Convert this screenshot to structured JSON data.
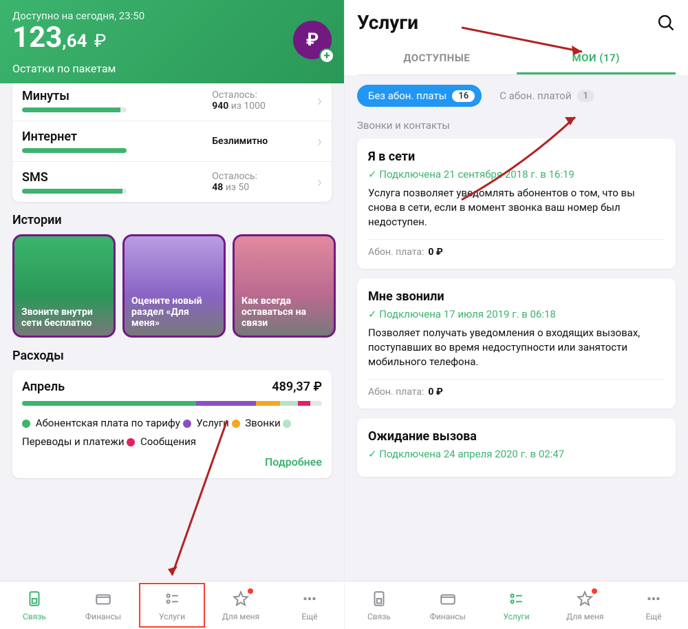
{
  "left": {
    "available_label": "Доступно на сегодня, 23:50",
    "balance_int": "123",
    "balance_dec": ",64",
    "balance_cur": "₽",
    "remain_label": "Остатки по пакетам",
    "packages": [
      {
        "title": "Минуты",
        "remain_label": "Осталось:",
        "remain_value": "940",
        "remain_of": "из 1000",
        "fill": 94
      },
      {
        "title": "Интернет",
        "remain_label": "",
        "remain_value": "Безлимитно",
        "remain_of": "",
        "fill": 100
      },
      {
        "title": "SMS",
        "remain_label": "Осталось:",
        "remain_value": "48",
        "remain_of": "из 50",
        "fill": 96
      }
    ],
    "stories_label": "Истории",
    "stories": [
      {
        "text": "Звоните внутри сети бесплатно"
      },
      {
        "text": "Оцените новый раздел «Для меня»"
      },
      {
        "text": "Как всегда оставаться на связи"
      }
    ],
    "expenses_label": "Расходы",
    "expenses": {
      "month": "Апрель",
      "amount": "489,37 ₽",
      "segments": [
        {
          "color": "#3cb46e",
          "w": 58
        },
        {
          "color": "#8a4fc7",
          "w": 20
        },
        {
          "color": "#f5a623",
          "w": 8
        },
        {
          "color": "#b6e3c6",
          "w": 6
        },
        {
          "color": "#e91e63",
          "w": 4
        },
        {
          "color": "#e5e5ea",
          "w": 4
        }
      ],
      "legend": [
        {
          "color": "#3cb46e",
          "label": "Абонентская плата по тарифу"
        },
        {
          "color": "#8a4fc7",
          "label": "Услуги"
        },
        {
          "color": "#f5a623",
          "label": "Звонки"
        },
        {
          "color": "#b6e3c6",
          "label": "Переводы и платежи"
        },
        {
          "color": "#e91e63",
          "label": "Сообщения"
        }
      ],
      "more": "Подробнее"
    }
  },
  "right": {
    "title": "Услуги",
    "tab_available": "ДОСТУПНЫЕ",
    "tab_my": "МОИ (17)",
    "chip_nofee": "Без абон. платы",
    "chip_nofee_n": "16",
    "chip_fee": "С абон. платой",
    "chip_fee_n": "1",
    "subsection": "Звонки и контакты",
    "services": [
      {
        "title": "Я в сети",
        "sub": "Подключена 21 сентября 2018 г. в 16:19",
        "desc": "Услуга позволяет уведомлять абонентов о том, что вы снова в сети, если в момент звонка ваш номер был недоступен.",
        "fee_label": "Абон. плата:",
        "fee": "0 ₽"
      },
      {
        "title": "Мне звонили",
        "sub": "Подключена 17 июля 2019 г. в 06:18",
        "desc": "Позволяет получать уведомления о входящих вызовах, поступавших во время недоступности или занятости мобильного телефона.",
        "fee_label": "Абон. плата:",
        "fee": "0 ₽"
      },
      {
        "title": "Ожидание вызова",
        "sub": "Подключена 24 апреля 2020 г. в 02:47",
        "desc": "",
        "fee_label": "",
        "fee": ""
      }
    ]
  },
  "tabs": [
    {
      "icon": "sim",
      "label": "Связь"
    },
    {
      "icon": "wallet",
      "label": "Финансы"
    },
    {
      "icon": "sliders",
      "label": "Услуги"
    },
    {
      "icon": "star",
      "label": "Для меня"
    },
    {
      "icon": "dots",
      "label": "Ещё"
    }
  ]
}
